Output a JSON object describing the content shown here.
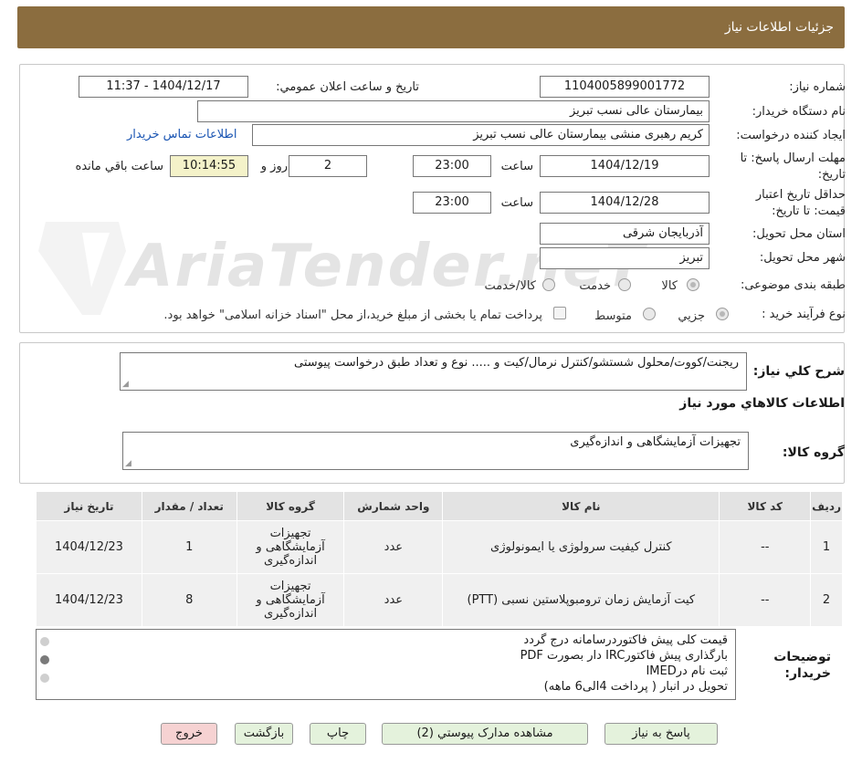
{
  "header": {
    "title": "جزئیات اطلاعات نیاز"
  },
  "form": {
    "need_number_label": "شماره نیاز:",
    "need_number": "1104005899001772",
    "announce_label": "تاریخ و ساعت اعلان عمومي:",
    "announce_value": "1404/12/17 - 11:37",
    "buyer_org_label": "نام دستگاه خريدار:",
    "buyer_org": "بیمارستان عالی نسب تبریز",
    "creator_label": "ايجاد کننده درخواست:",
    "creator": "کریم رهبری منشی بیمارستان عالی نسب تبریز",
    "contact_link": "اطلاعات تماس خريدار",
    "deadline_label_1": "مهلت ارسال پاسخ: تا",
    "deadline_label_2": "تاریخ:",
    "deadline_date": "1404/12/19",
    "time_label": "ساعت",
    "deadline_time": "23:00",
    "days_value": "2",
    "days_label": "روز و",
    "remaining_time": "10:14:55",
    "remaining_label": "ساعت باقي مانده",
    "validity_label_1": "حداقل تاریخ اعتبار",
    "validity_label_2": "قیمت: تا تاریخ:",
    "validity_date": "1404/12/28",
    "validity_time_label": "ساعت",
    "validity_time": "23:00",
    "province_label": "استان محل تحویل:",
    "province": "آذربایجان شرقی",
    "city_label": "شهر محل تحویل:",
    "city": "تبریز",
    "category_label": "طبقه بندی موضوعی:",
    "category_options": [
      "کالا",
      "خدمت",
      "کالا/خدمت"
    ],
    "category_selected": "کالا",
    "process_label": "نوع فرآیند خرید :",
    "process_options": [
      "جزيي",
      "متوسط"
    ],
    "process_selected": "جزيي",
    "payment_note": "پرداخت تمام یا بخشی از مبلغ خرید،از محل \"اسناد خزانه اسلامی\" خواهد بود."
  },
  "description": {
    "label": "شرح کلي نياز:",
    "text": "ریجنت/کووت/محلول شستشو/کنترل نرمال/کیت و ..... نوع و تعداد طبق درخواست پیوستی"
  },
  "goods_section": {
    "title": "اطلاعات کالاهاي مورد نياز",
    "group_label": "گروه کالا:",
    "group_value": "تجهیزات آزمایشگاهی و اندازه‌گیری"
  },
  "table": {
    "headers": [
      "رديف",
      "کد کالا",
      "نام کالا",
      "واحد شمارش",
      "گروه کالا",
      "تعداد / مقدار",
      "تاريخ نياز"
    ],
    "rows": [
      {
        "row": "1",
        "code": "--",
        "name": "کنترل کیفیت سرولوژی یا ایمونولوژی",
        "unit": "عدد",
        "group_1": "تجهیزات",
        "group_2": "آزمایشگاهی و",
        "group_3": "اندازه‌گیری",
        "qty": "1",
        "date": "1404/12/23"
      },
      {
        "row": "2",
        "code": "--",
        "name": "کیت آزمایش زمان ترومبوپلاستین نسبی (PTT)",
        "unit": "عدد",
        "group_1": "تجهیزات",
        "group_2": "آزمایشگاهی و",
        "group_3": "اندازه‌گیری",
        "qty": "8",
        "date": "1404/12/23"
      }
    ]
  },
  "buyer_notes": {
    "label_1": "توضيحات",
    "label_2": "خريدار:",
    "lines": [
      "قیمت کلی پیش فاکتوردرسامانه درج گردد",
      "بارگذاری پیش فاکتورIRC دار بصورت PDF",
      "ثبت نام درIMED",
      "تحویل در انبار ( پرداخت 4الی6 ماهه)"
    ]
  },
  "buttons": {
    "reply": "پاسخ به نياز",
    "attachments": "مشاهده مدارک پيوستي (2)",
    "print": "چاپ",
    "back": "بازگشت",
    "exit": "خروج"
  },
  "watermark": {
    "text": "AriaTender.neT"
  },
  "colors": {
    "header": "#8b6d3f",
    "link": "#1a55b3",
    "button": "#e4f2dc",
    "exit": "#f6d2d2",
    "time_highlight": "#f4f2c9"
  }
}
